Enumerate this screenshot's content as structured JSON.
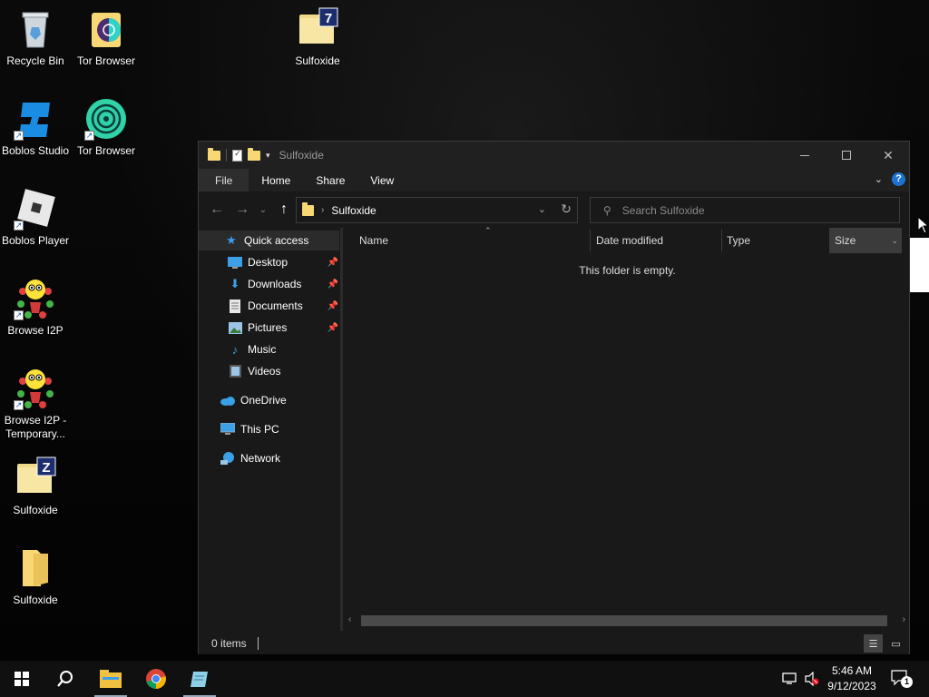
{
  "desktop": {
    "icons": [
      {
        "label": "Recycle Bin",
        "icon": "recycle-bin-icon"
      },
      {
        "label": "Tor Browser",
        "icon": "folder-tor-icon"
      },
      {
        "label": "Sulfoxide",
        "icon": "folder-7zip-icon"
      },
      {
        "label": "Boblos Studio",
        "icon": "boblos-studio-icon"
      },
      {
        "label": "Tor Browser",
        "icon": "tor-browser-icon"
      },
      {
        "label": "Boblos Player",
        "icon": "boblos-player-icon"
      },
      {
        "label": "Browse I2P",
        "icon": "i2p-icon"
      },
      {
        "label": "Browse I2P - Temporary...",
        "icon": "i2p-icon"
      },
      {
        "label": "Sulfoxide",
        "icon": "folder-zip-icon"
      },
      {
        "label": "Sulfoxide",
        "icon": "folder-icon"
      }
    ]
  },
  "explorer": {
    "title": "Sulfoxide",
    "ribbon_tabs": [
      "File",
      "Home",
      "Share",
      "View"
    ],
    "address": {
      "crumb": "Sulfoxide"
    },
    "search": {
      "placeholder": "Search Sulfoxide"
    },
    "nav_pane": {
      "quick_access": "Quick access",
      "quick_items": [
        {
          "label": "Desktop",
          "pinned": true
        },
        {
          "label": "Downloads",
          "pinned": true
        },
        {
          "label": "Documents",
          "pinned": true
        },
        {
          "label": "Pictures",
          "pinned": true
        },
        {
          "label": "Music",
          "pinned": false
        },
        {
          "label": "Videos",
          "pinned": false
        }
      ],
      "onedrive": "OneDrive",
      "this_pc": "This PC",
      "network": "Network"
    },
    "columns": [
      "Name",
      "Date modified",
      "Type",
      "Size"
    ],
    "empty_message": "This folder is empty.",
    "status": {
      "items": "0 items"
    }
  },
  "taskbar": {
    "time": "5:46 AM",
    "date": "9/12/2023",
    "notification_count": "1",
    "pinned": [
      "start-button",
      "search-button",
      "file-explorer",
      "chrome",
      "notepad"
    ]
  },
  "colors": {
    "folder": "#f8d775",
    "accent": "#1e73d2",
    "window_bg": "#191919",
    "titlebar_bg": "#202020"
  }
}
